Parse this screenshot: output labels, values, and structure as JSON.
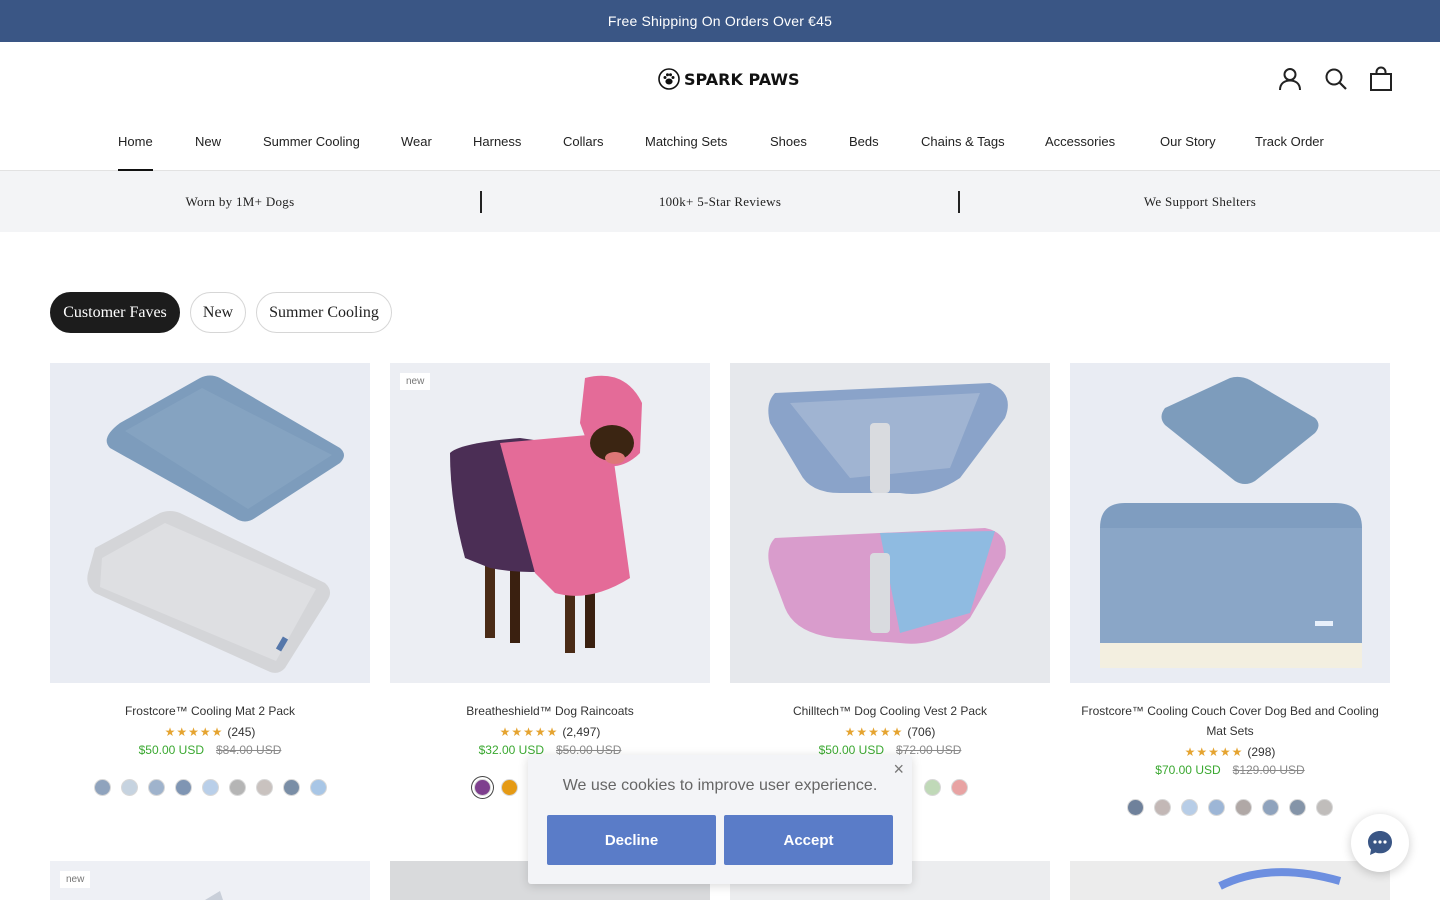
{
  "announcement": "Free Shipping On Orders Over €45",
  "brand": {
    "name": "SPARK PAWS"
  },
  "header_icons": [
    "account-icon",
    "search-icon",
    "bag-icon"
  ],
  "nav": {
    "items": [
      "Home",
      "New",
      "Summer Cooling",
      "Wear",
      "Harness",
      "Collars",
      "Matching Sets",
      "Shoes",
      "Beds",
      "Chains & Tags",
      "Accessories",
      "Our Story",
      "Track Order"
    ],
    "active": "Home"
  },
  "trust": [
    "Worn by 1M+ Dogs",
    "100k+ 5-Star Reviews",
    "We Support Shelters"
  ],
  "filters": {
    "tabs": [
      "Customer Faves",
      "New",
      "Summer Cooling"
    ],
    "active": "Customer Faves"
  },
  "products": [
    {
      "title": "Frostcore™ Cooling Mat 2 Pack",
      "stars": "★★★★★",
      "reviews": "(245)",
      "price": "$50.00 USD",
      "compare": "$84.00 USD",
      "badge": "",
      "swatches": [
        "#8fa3bd",
        "#c6d3e0",
        "#9fb3cc",
        "#7f95b3",
        "#b9cfe9",
        "#b5b5b5",
        "#c9c2bf",
        "#7a8ea6",
        "#a8c6e6"
      ]
    },
    {
      "title": "Breatheshield™ Dog Raincoats",
      "stars": "★★★★★",
      "reviews": "(2,497)",
      "price": "$32.00 USD",
      "compare": "$50.00 USD",
      "badge": "new",
      "swatches": [
        "#7e3f8e",
        "#e59a14",
        "#2f3a4d",
        "#3a2a1a",
        "#d98b98",
        "#1b7a7a"
      ]
    },
    {
      "title": "Chilltech™ Dog Cooling Vest 2 Pack",
      "stars": "★★★★★",
      "reviews": "(706)",
      "price": "$50.00 USD",
      "compare": "$72.00 USD",
      "badge": "",
      "swatches": [
        "#c0d9b8",
        "#e8a3a3"
      ]
    },
    {
      "title": "Frostcore™ Cooling Couch Cover Dog Bed and Cooling Mat Sets",
      "stars": "★★★★★",
      "reviews": "(298)",
      "price": "$70.00 USD",
      "compare": "$129.00 USD",
      "badge": "",
      "swatches": [
        "#6f819b",
        "#c3b8b6",
        "#b7cde7",
        "#9db6d6",
        "#b0a8a6",
        "#8fa3bd",
        "#8494a8",
        "#c0bdbb"
      ]
    }
  ],
  "row2_badges": [
    "new",
    "",
    "",
    ""
  ],
  "cookie": {
    "message": "We use cookies to improve user experience.",
    "decline": "Decline",
    "accept": "Accept",
    "close": "×"
  },
  "colors": {
    "announcement_bg": "#3a5685",
    "price_green": "#3aa830",
    "cookie_button": "#5a7cc8",
    "product_bg": "#e9ecf3"
  }
}
